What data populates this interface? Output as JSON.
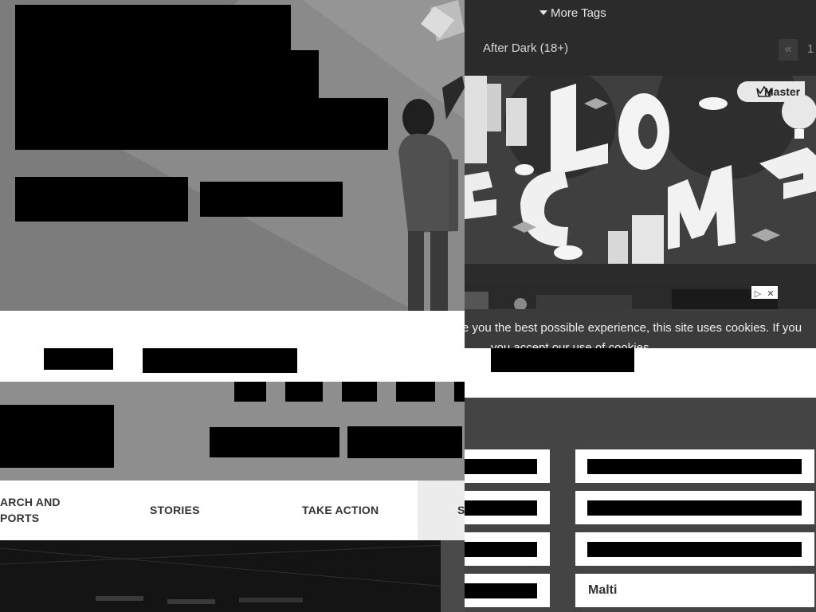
{
  "left_panel": {
    "nav": {
      "items": [
        {
          "label_line1": "ARCH AND",
          "label_line2": "PORTS"
        },
        {
          "label": "STORIES"
        },
        {
          "label": "TAKE ACTION"
        },
        {
          "label": "S"
        }
      ]
    }
  },
  "right_panel": {
    "more_tags_label": "More Tags",
    "filter_label": "After Dark (18+)",
    "pager": {
      "prev": "«",
      "page": "1"
    },
    "welcome_banner": {
      "badge": "Master"
    },
    "ad": {
      "adchoices": "▷",
      "close": "✕"
    },
    "cookie_notice": {
      "line1": "e you the best possible experience, this site uses cookies. If you",
      "line2": "you accept our use of cookies."
    },
    "languages": {
      "visible_label": "Malti"
    }
  },
  "colors": {
    "hero_bg": "#7c7c7c",
    "right_bg": "#2b2b2b",
    "nav_bg": "#ffffff",
    "redaction": "#000000"
  }
}
